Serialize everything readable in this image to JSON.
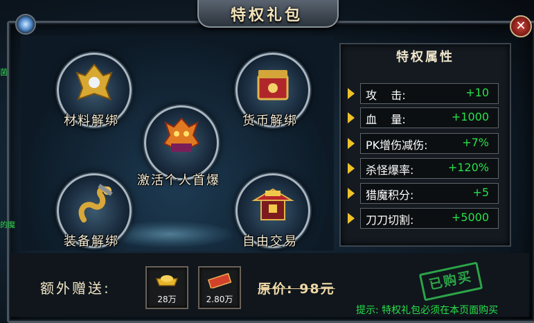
{
  "window": {
    "title": "特权礼包",
    "close_icon": "close-icon",
    "top_left_icon": "gem-icon"
  },
  "packages": [
    {
      "label": "材料解绑",
      "icon": "golden-mask-icon"
    },
    {
      "label": "货币解绑",
      "icon": "treasure-box-icon"
    },
    {
      "label": "激活个人首爆",
      "icon": "demon-chest-icon"
    },
    {
      "label": "装备解绑",
      "icon": "dragon-icon"
    },
    {
      "label": "自由交易",
      "icon": "pavilion-icon"
    }
  ],
  "attributes": {
    "title": "特权属性",
    "rows": [
      {
        "name": "攻    击:",
        "value": "+10"
      },
      {
        "name": "血    量:",
        "value": "+1000"
      },
      {
        "name": "PK增伤减伤:",
        "value": "+7%"
      },
      {
        "name": "杀怪爆率:",
        "value": "+120%"
      },
      {
        "name": "猎魔积分:",
        "value": "+5"
      },
      {
        "name": "刀刀切割:",
        "value": "+5000"
      }
    ]
  },
  "bonus": {
    "label": "额外赠送:",
    "items": [
      {
        "qty": "28万",
        "icon": "gold-ingot-icon"
      },
      {
        "qty": "2.80万",
        "icon": "red-ticket-icon"
      }
    ]
  },
  "price_text": "原价: 98元",
  "stamp": "已购买",
  "hint": "提示: 特权礼包必须在本页面购买",
  "side_texts": [
    "菌",
    "的魔"
  ],
  "colors": {
    "attr_value": "#28e04a",
    "arrow": "#f0c22a",
    "stamp": "#2ca548"
  }
}
